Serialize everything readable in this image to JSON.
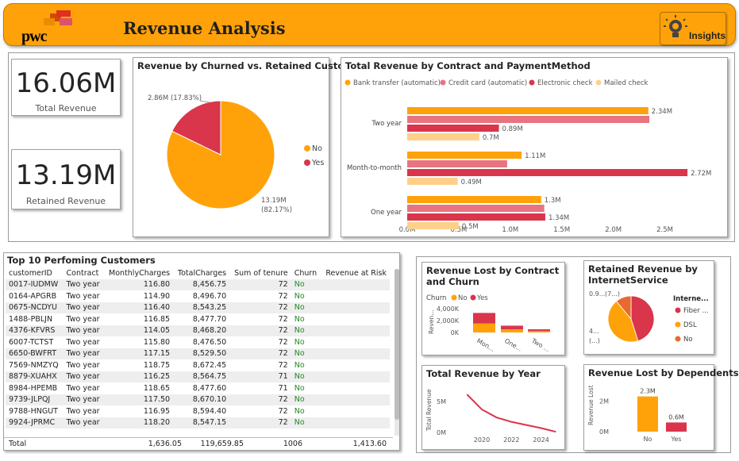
{
  "header": {
    "logo_text": "pwc",
    "title": "Revenue Analysis",
    "insights_label": "Insights"
  },
  "kpis": [
    {
      "value": "16.06M",
      "label": "Total Revenue"
    },
    {
      "value": "13.19M",
      "label": "Retained Revenue"
    }
  ],
  "colors": {
    "orange": "#FFA20A",
    "red": "#D9354B",
    "pink": "#E8747F",
    "light": "#FFD08A",
    "green": "#218A21"
  },
  "chart_data": [
    {
      "type": "pie",
      "title": "Revenue by Churned vs. Retained Customer",
      "legend_title": "",
      "legend_position": "right",
      "slices": [
        {
          "name": "No",
          "value": 13.19,
          "label": "13.19M",
          "pct": "(82.17%)"
        },
        {
          "name": "Yes",
          "value": 2.86,
          "label": "2.86M (17.83%)"
        }
      ]
    },
    {
      "type": "bar",
      "orientation": "horizontal",
      "title": "Total Revenue by Contract and PaymentMethod",
      "legend_position": "top",
      "categories": [
        "Two year",
        "Month-to-month",
        "One year"
      ],
      "series": [
        {
          "name": "Bank transfer (automatic)",
          "values": [
            2.34,
            1.11,
            1.3
          ],
          "labels": [
            "2.34M",
            "1.11M",
            "1.3M"
          ]
        },
        {
          "name": "Credit card (automatic)",
          "values": [
            2.35,
            0.97,
            1.33
          ],
          "labels": [
            "",
            "",
            ""
          ]
        },
        {
          "name": "Electronic check",
          "values": [
            0.89,
            2.72,
            1.34
          ],
          "labels": [
            "0.89M",
            "2.72M",
            "1.34M"
          ]
        },
        {
          "name": "Mailed check",
          "values": [
            0.7,
            0.49,
            0.5
          ],
          "labels": [
            "0.7M",
            "0.49M",
            "0.5M"
          ]
        }
      ],
      "ticks": [
        "0.0M",
        "0.5M",
        "1.0M",
        "1.5M",
        "2.0M",
        "2.5M"
      ],
      "xlim": [
        0,
        2.75
      ]
    },
    {
      "type": "bar",
      "stacked": true,
      "title": "Revenue Lost by Contract and Churn",
      "legend_title": "Churn",
      "categories": [
        "Mon...",
        "One...",
        "Two ..."
      ],
      "series": [
        {
          "name": "No",
          "values": [
            1500,
            520,
            230
          ]
        },
        {
          "name": "Yes",
          "values": [
            1780,
            620,
            300
          ]
        }
      ],
      "ylabel": "Reven...",
      "yticks": [
        "4,000K",
        "2,000K",
        "0K"
      ],
      "ylim": [
        0,
        4000
      ]
    },
    {
      "type": "pie",
      "title": "Retained Revenue by InternetService",
      "legend_title": "Interne...",
      "slices": [
        {
          "name": "Fiber ...",
          "value": 5.95
        },
        {
          "name": "DSL",
          "value": 5.79
        },
        {
          "name": "No",
          "value": 1.45
        }
      ],
      "label_top": "0.9...",
      "label_top2": "(7...)",
      "label_bottom": "4...",
      "label_bottom2": "(...)"
    },
    {
      "type": "line",
      "title": "Total Revenue by Year",
      "ylabel": "Total Revenue",
      "yticks": [
        "5M",
        "0M"
      ],
      "xticks": [
        "2020",
        "2022",
        "2024"
      ],
      "x": [
        2019,
        2020,
        2021,
        2022,
        2023,
        2024,
        2025
      ],
      "y": [
        6.1,
        3.7,
        2.4,
        1.7,
        1.2,
        0.7,
        0.1
      ],
      "xlim": [
        2018.5,
        2025.2
      ],
      "ylim": [
        0,
        6.5
      ]
    },
    {
      "type": "bar",
      "title": "Revenue Lost by Dependents",
      "ylabel": "Revenue Lost",
      "yticks": [
        "2M",
        "0M"
      ],
      "categories": [
        "No",
        "Yes"
      ],
      "values": [
        2.3,
        0.6
      ],
      "labels": [
        "2.3M",
        "0.6M"
      ],
      "value_colors": [
        "#FFA20A",
        "#D9354B"
      ],
      "ylim": [
        0,
        2.8
      ]
    }
  ],
  "table": {
    "title": "Top 10 Perfoming Customers",
    "columns": [
      "customerID",
      "Contract",
      "MonthlyCharges",
      "TotalCharges",
      "Sum of tenure",
      "Churn",
      "Revenue at Risk"
    ],
    "rows": [
      [
        "0017-IUDMW",
        "Two year",
        "116.80",
        "8,456.75",
        "72",
        "No",
        ""
      ],
      [
        "0164-APGRB",
        "Two year",
        "114.90",
        "8,496.70",
        "72",
        "No",
        ""
      ],
      [
        "0675-NCDYU",
        "Two year",
        "116.40",
        "8,543.25",
        "72",
        "No",
        ""
      ],
      [
        "1488-PBLJN",
        "Two year",
        "116.85",
        "8,477.70",
        "72",
        "No",
        ""
      ],
      [
        "4376-KFVRS",
        "Two year",
        "114.05",
        "8,468.20",
        "72",
        "No",
        ""
      ],
      [
        "6007-TCTST",
        "Two year",
        "115.80",
        "8,476.50",
        "72",
        "No",
        ""
      ],
      [
        "6650-BWFRT",
        "Two year",
        "117.15",
        "8,529.50",
        "72",
        "No",
        ""
      ],
      [
        "7569-NMZYQ",
        "Two year",
        "118.75",
        "8,672.45",
        "72",
        "No",
        ""
      ],
      [
        "8879-XUAHX",
        "Two year",
        "116.25",
        "8,564.75",
        "71",
        "No",
        ""
      ],
      [
        "8984-HPEMB",
        "Two year",
        "118.65",
        "8,477.60",
        "71",
        "No",
        ""
      ],
      [
        "9739-JLPQJ",
        "Two year",
        "117.50",
        "8,670.10",
        "72",
        "No",
        ""
      ],
      [
        "9788-HNGUT",
        "Two year",
        "116.95",
        "8,594.40",
        "72",
        "No",
        ""
      ],
      [
        "9924-JPRMC",
        "Two year",
        "118.20",
        "8,547.15",
        "72",
        "No",
        ""
      ]
    ],
    "total": [
      "Total",
      "",
      "1,636.05",
      "119,659.85",
      "1006",
      "",
      "1,413.60"
    ]
  }
}
